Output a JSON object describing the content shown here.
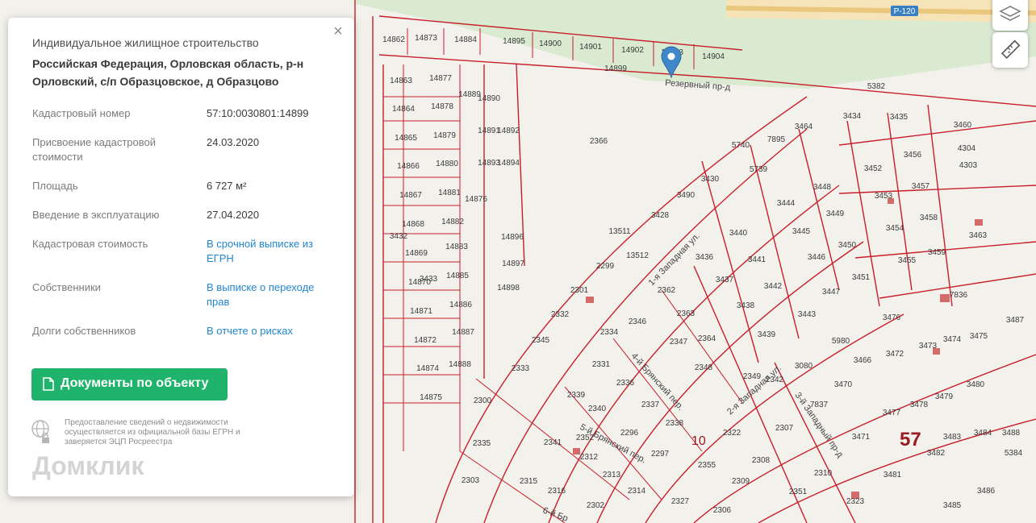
{
  "map": {
    "road_badge": "Р-120",
    "street_labels": [
      "Резервный пр-д",
      "1-я Западная ул.",
      "2-я Западная ул.",
      "3-й Западный пр-д",
      "4-й Брянский пер.",
      "5-й Брянский пер.",
      "6-й Бр"
    ],
    "block_numbers": [
      "57",
      "10"
    ],
    "parcel_numbers": [
      "14862",
      "14873",
      "14884",
      "14895",
      "14900",
      "14901",
      "14902",
      "14903",
      "14904",
      "14899",
      "5382",
      "14863",
      "14877",
      "14864",
      "14878",
      "14865",
      "14879",
      "14866",
      "14880",
      "14867",
      "14881",
      "14868",
      "14882",
      "14869",
      "14883",
      "14870",
      "14885",
      "14871",
      "14886",
      "14872",
      "14887",
      "14874",
      "14888",
      "14875",
      "14876",
      "14889",
      "14890",
      "14891",
      "14892",
      "14893",
      "14894",
      "14896",
      "14897",
      "14898",
      "2366",
      "5740",
      "5739",
      "3434",
      "3435",
      "3460",
      "4304",
      "4303",
      "3456",
      "3452",
      "3457",
      "3453",
      "3454",
      "3458",
      "3455",
      "3459",
      "3463",
      "3428",
      "3490",
      "3430",
      "3448",
      "3444",
      "3449",
      "3445",
      "3450",
      "3446",
      "3451",
      "3447",
      "3440",
      "3436",
      "3441",
      "3437",
      "3442",
      "3438",
      "3443",
      "3439",
      "13511",
      "13512",
      "2299",
      "2301",
      "2362",
      "2363",
      "2364",
      "2332",
      "2346",
      "2347",
      "2348",
      "2349",
      "2345",
      "2333",
      "2334",
      "2331",
      "2336",
      "2337",
      "2338",
      "2339",
      "2340",
      "2296",
      "2297",
      "2300",
      "2335",
      "2341",
      "2312",
      "2313",
      "2314",
      "2315",
      "2316",
      "2302",
      "2303",
      "2342",
      "2322",
      "2307",
      "2355",
      "2308",
      "2309",
      "2306",
      "2310",
      "2351",
      "2323",
      "2327",
      "2352",
      "3080",
      "5980",
      "3466",
      "3472",
      "3473",
      "3474",
      "3475",
      "3476",
      "7836",
      "7837",
      "3470",
      "3471",
      "3477",
      "3478",
      "3479",
      "3480",
      "3481",
      "3482",
      "3483",
      "3484",
      "3485",
      "3486",
      "3487",
      "3488",
      "5384",
      "7895",
      "3464",
      "3432",
      "3433"
    ],
    "marker_label": "14899"
  },
  "card": {
    "close_label": "×",
    "property_type": "Индивидуальное жилищное строительство",
    "address": "Российская Федерация, Орловская область, р-н Орловский, с/п Образцовское, д Образцово",
    "rows": [
      {
        "label": "Кадастровый номер",
        "value": "57:10:0030801:14899",
        "link": false
      },
      {
        "label": "Присвоение кадастровой стоимости",
        "value": "24.03.2020",
        "link": false
      },
      {
        "label": "Площадь",
        "value": "6 727 м²",
        "link": false
      },
      {
        "label": "Введение в эксплуатацию",
        "value": "27.04.2020",
        "link": false
      },
      {
        "label": "Кадастровая стоимость",
        "value": "В срочной выписке из ЕГРН",
        "link": true
      },
      {
        "label": "Собственники",
        "value": "В выписке о переходе прав",
        "link": true
      },
      {
        "label": "Долги собственников",
        "value": "В отчете о рисках",
        "link": true
      }
    ],
    "documents_button": "Документы по объекту",
    "disclaimer": "Предоставление сведений о недвижимости осуществляется из официальной базы ЕГРН и заверяется ЭЦП Росреестра",
    "watermark": "Домклик"
  },
  "colors": {
    "parcel_line": "#c81e2a",
    "accent_green": "#20b36b",
    "link_blue": "#1f86cf",
    "marker_blue": "#3f87c8",
    "road_badge_bg": "#3a7fc1"
  },
  "controls": {
    "layers": "layers-icon",
    "ruler": "ruler-icon"
  }
}
